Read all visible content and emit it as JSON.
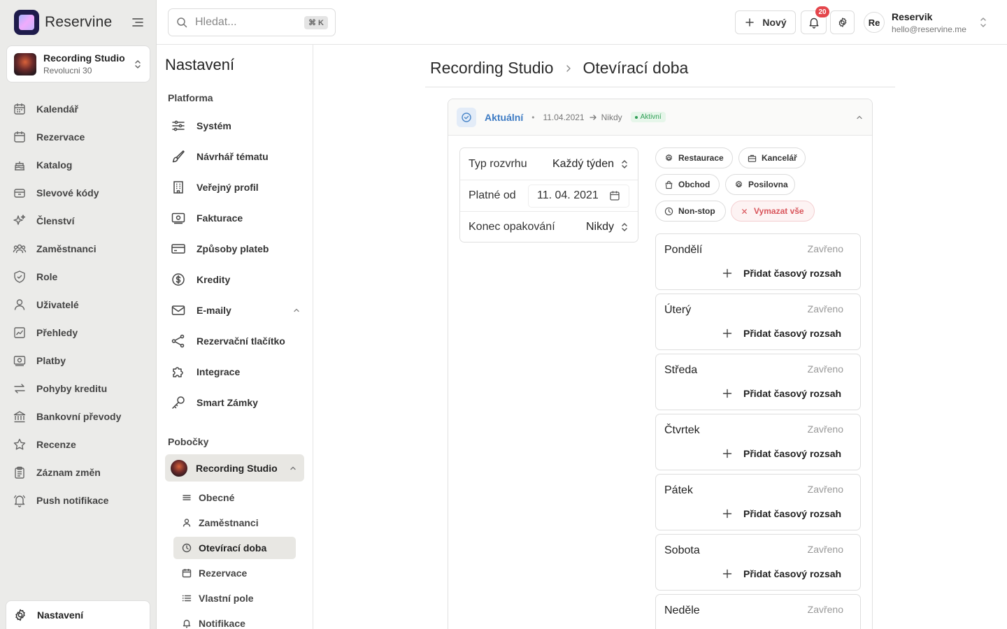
{
  "app": {
    "name": "Reservine"
  },
  "studio_switcher": {
    "name": "Recording Studio",
    "address": "Revolucni 30"
  },
  "sidebar": {
    "items": [
      {
        "label": "Kalendář",
        "icon": "calendar-icon"
      },
      {
        "label": "Rezervace",
        "icon": "calendar-check-icon"
      },
      {
        "label": "Katalog",
        "icon": "cake-icon"
      },
      {
        "label": "Slevové kódy",
        "icon": "ticket-icon"
      },
      {
        "label": "Členství",
        "icon": "sparkles-icon"
      },
      {
        "label": "Zaměstnanci",
        "icon": "users-icon"
      },
      {
        "label": "Role",
        "icon": "shield-icon"
      },
      {
        "label": "Uživatelé",
        "icon": "user-icon"
      },
      {
        "label": "Přehledy",
        "icon": "chart-icon"
      },
      {
        "label": "Platby",
        "icon": "banknote-icon"
      },
      {
        "label": "Pohyby kreditu",
        "icon": "arrows-icon"
      },
      {
        "label": "Bankovní převody",
        "icon": "bank-icon"
      },
      {
        "label": "Recenze",
        "icon": "star-icon"
      },
      {
        "label": "Záznam změn",
        "icon": "clipboard-icon"
      },
      {
        "label": "Push notifikace",
        "icon": "bell-ring-icon"
      }
    ],
    "settings_label": "Nastavení"
  },
  "topbar": {
    "search_placeholder": "Hledat...",
    "search_shortcut": "⌘ K",
    "new_label": "Nový",
    "notification_count": "20",
    "user_initials": "Re",
    "user_name": "Reservik",
    "user_email": "hello@reservine.me"
  },
  "settings": {
    "title": "Nastavení",
    "platform_label": "Platforma",
    "platform_items": [
      {
        "label": "Systém",
        "icon": "sliders-icon"
      },
      {
        "label": "Návrhář tématu",
        "icon": "brush-icon"
      },
      {
        "label": "Veřejný profil",
        "icon": "building-icon"
      },
      {
        "label": "Fakturace",
        "icon": "invoice-icon"
      },
      {
        "label": "Způsoby plateb",
        "icon": "credit-card-icon"
      },
      {
        "label": "Kredity",
        "icon": "dollar-circle-icon"
      },
      {
        "label": "E-maily",
        "icon": "mail-icon"
      },
      {
        "label": "Rezervační tlačítko",
        "icon": "share-icon"
      },
      {
        "label": "Integrace",
        "icon": "puzzle-icon"
      },
      {
        "label": "Smart Zámky",
        "icon": "key-icon"
      }
    ],
    "branches_label": "Pobočky",
    "branch_name": "Recording Studio",
    "branch_items": [
      {
        "label": "Obecné",
        "icon": "sliders-icon"
      },
      {
        "label": "Zaměstnanci",
        "icon": "user-icon"
      },
      {
        "label": "Otevírací doba",
        "icon": "clock-icon"
      },
      {
        "label": "Rezervace",
        "icon": "calendar-icon"
      },
      {
        "label": "Vlastní pole",
        "icon": "list-icon"
      },
      {
        "label": "Notifikace",
        "icon": "bell-icon"
      }
    ]
  },
  "main": {
    "breadcrumb": [
      "Recording Studio",
      "Otevírací doba"
    ],
    "period": {
      "label": "Aktuální",
      "from": "11.04.2021",
      "to": "Nikdy",
      "status": "Aktivní"
    },
    "form": {
      "schedule_type_label": "Typ rozvrhu",
      "schedule_type_value": "Každý týden",
      "valid_from_label": "Platné od",
      "valid_from_value": "11. 04. 2021",
      "repeat_end_label": "Konec opakování",
      "repeat_end_value": "Nikdy"
    },
    "presets": [
      {
        "label": "Restaurace",
        "icon": "cog-icon"
      },
      {
        "label": "Kancelář",
        "icon": "briefcase-icon"
      },
      {
        "label": "Obchod",
        "icon": "bag-icon"
      },
      {
        "label": "Posilovna",
        "icon": "cog-icon"
      },
      {
        "label": "Non-stop",
        "icon": "clock-icon"
      },
      {
        "label": "Vymazat vše",
        "icon": "x-icon"
      }
    ],
    "add_range_label": "Přidat časový rozsah",
    "days": [
      {
        "name": "Pondělí",
        "status": "Zavřeno"
      },
      {
        "name": "Úterý",
        "status": "Zavřeno"
      },
      {
        "name": "Středa",
        "status": "Zavřeno"
      },
      {
        "name": "Čtvrtek",
        "status": "Zavřeno"
      },
      {
        "name": "Pátek",
        "status": "Zavřeno"
      },
      {
        "name": "Sobota",
        "status": "Zavřeno"
      },
      {
        "name": "Neděle",
        "status": "Zavřeno"
      }
    ]
  }
}
